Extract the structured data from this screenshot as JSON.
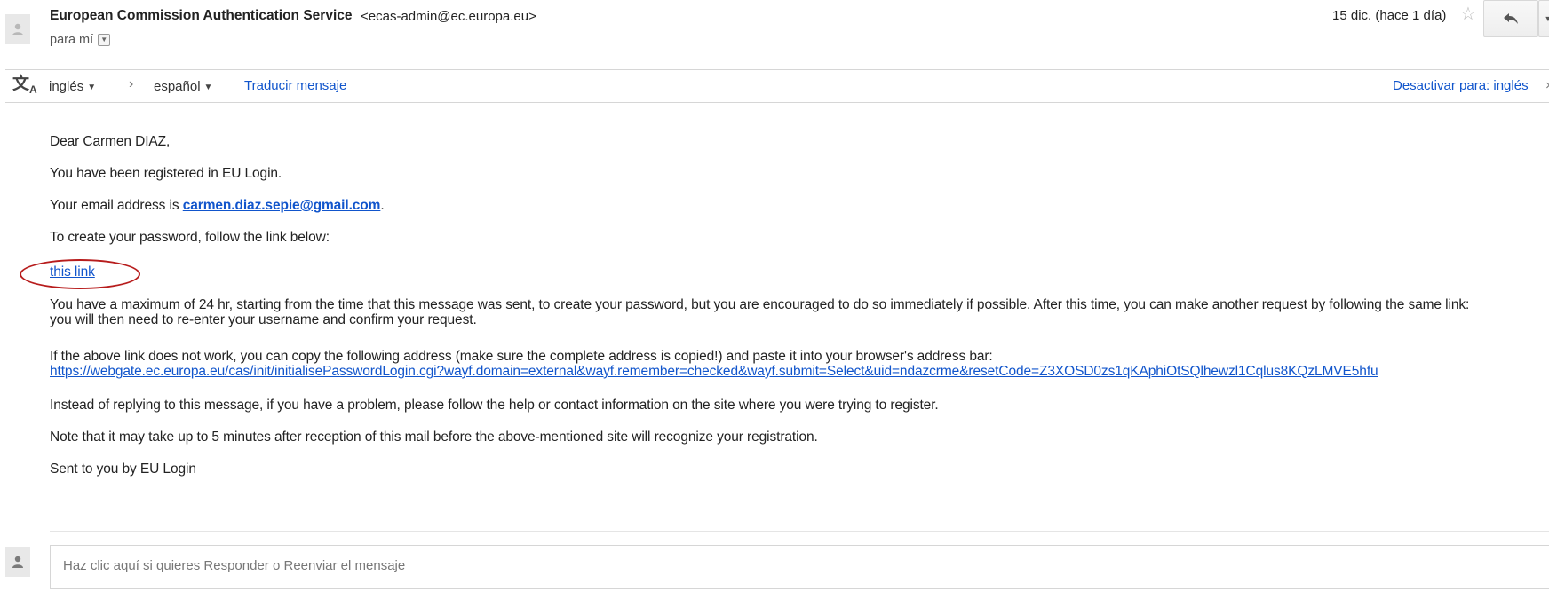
{
  "header": {
    "sender_name": "European Commission Authentication Service",
    "sender_email": "<ecas-admin@ec.europa.eu>",
    "to_label": "para mí",
    "date": "15 dic. (hace 1 día)"
  },
  "translate_bar": {
    "from_language": "inglés",
    "to_language": "español",
    "translate_link": "Traducir mensaje",
    "disable_link": "Desactivar para: inglés"
  },
  "body": {
    "greeting": "Dear Carmen DIAZ,",
    "registered": "You have been registered in EU Login.",
    "email_prefix": "Your email address is ",
    "email_address": "carmen.diaz.sepie@gmail.com",
    "email_suffix": ".",
    "create_password": "To create your password, follow the link below:",
    "link_text": "this link",
    "max_time_line1": "You have a maximum of 24 hr, starting from the time that this message was sent, to create your password, but you are encouraged to do so immediately if possible. After this time, you can make another request by following the same link:",
    "max_time_line2": "you will then need to re-enter your username and confirm your request.",
    "copy_address": "If the above link does not work, you can copy the following address (make sure the complete address is copied!) and paste it into your browser's address bar:",
    "url": "https://webgate.ec.europa.eu/cas/init/initialisePasswordLogin.cgi?wayf.domain=external&wayf.remember=checked&wayf.submit=Select&uid=ndazcrme&resetCode=Z3XOSD0zs1qKAphiOtSQlhewzl1Cqlus8KQzLMVE5hfu",
    "instead_reply": "Instead of replying to this message, if you have a problem, please follow the help or contact information on the site where you were trying to register.",
    "note_minutes": "Note that it may take up to 5 minutes after reception of this mail before the above-mentioned site will recognize your registration.",
    "sent_by": "Sent to you by EU Login"
  },
  "reply": {
    "prefix": "Haz clic aquí si quieres ",
    "reply_link": "Responder",
    "middle": " o ",
    "forward_link": "Reenviar",
    "suffix": " el mensaje"
  },
  "colors": {
    "link": "#1155cc",
    "highlight": "#b71c1c",
    "border": "#d6d6d6"
  }
}
